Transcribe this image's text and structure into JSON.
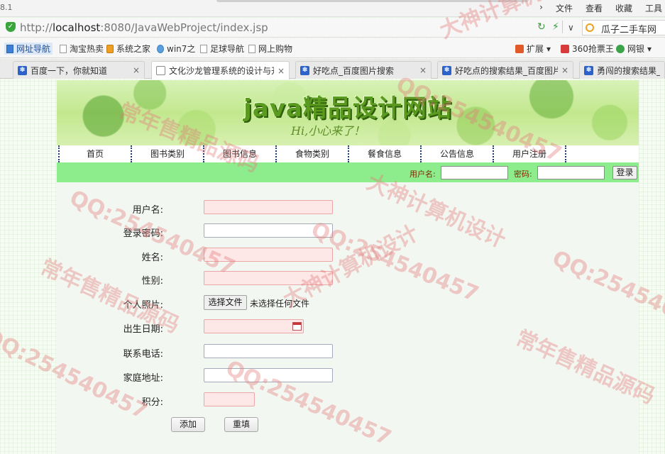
{
  "browser": {
    "version_fragment": "8.1",
    "menu": [
      "文件",
      "查看",
      "收藏",
      "工具"
    ],
    "url_prefix": "http://",
    "url_host": "localhost",
    "url_rest": ":8080/JavaWebProject/index.jsp",
    "search_text": "瓜子二手车网",
    "favorites": [
      "网址导航",
      "淘宝热卖",
      "系统之家",
      "win7之",
      "足球导航",
      "网上购物"
    ],
    "favorites_right": [
      "扩展",
      "360抢票王",
      "网银"
    ],
    "tabs": [
      {
        "label": "百度一下，你就知道",
        "active": false
      },
      {
        "label": "文化沙龙管理系统的设计与开发",
        "active": true
      },
      {
        "label": "好吃点_百度图片搜索",
        "active": false
      },
      {
        "label": "好吃点的搜索结果_百度图片搜",
        "active": false
      },
      {
        "label": "勇闯的搜索结果_百度",
        "active": false
      }
    ]
  },
  "site": {
    "banner_title": "java精品设计网站",
    "banner_subtitle": "Hi,小心来了！",
    "nav": [
      "首页",
      "图书类别",
      "图书信息",
      "食物类别",
      "餐食信息",
      "公告信息",
      "用户注册"
    ],
    "login": {
      "username_label": "用户名:",
      "password_label": "密码:",
      "button": "登录"
    }
  },
  "form": {
    "fields": [
      {
        "label": "用户名:",
        "style": "req"
      },
      {
        "label": "登录密码:",
        "style": "plain"
      },
      {
        "label": "姓名:",
        "style": "req"
      },
      {
        "label": "性别:",
        "style": "req"
      },
      {
        "label": "个人照片:",
        "style": "file"
      },
      {
        "label": "出生日期:",
        "style": "date"
      },
      {
        "label": "联系电话:",
        "style": "plain"
      },
      {
        "label": "家庭地址:",
        "style": "plain"
      },
      {
        "label": "积分:",
        "style": "short"
      }
    ],
    "file_button": "选择文件",
    "file_status": "未选择任何文件",
    "add_button": "添加",
    "reset_button": "重填"
  },
  "watermark": {
    "qq": "QQ:254540457",
    "seller": "常年售精品源码",
    "design": "大神计算机设计"
  },
  "colors": {
    "login_bar": "#8ded8d",
    "required_field": "#fde7e7",
    "watermark": "#e27878"
  }
}
